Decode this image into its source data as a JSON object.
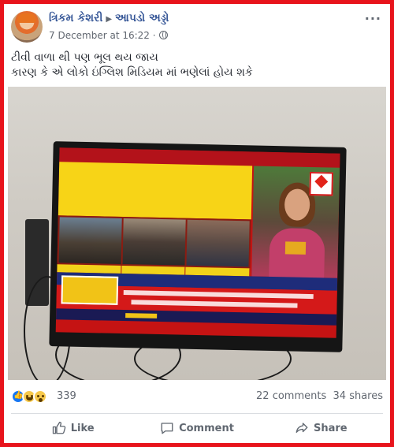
{
  "post": {
    "author": "ત્રિકમ કેશરી",
    "group": "આપડો અડ્ડો",
    "timestamp": "7 December at 16:22",
    "menu_icon": "more-dots-icon",
    "privacy_icon": "globe-icon",
    "text_line1": "ટીવી વાળા થી પણ ભૂલ થય જાય",
    "text_line2": "કારણ કે એ લોકો ઇંગ્લિશ મિડિયમ માં ભણેલાં હોય શકે"
  },
  "reactions": {
    "icons": [
      "like-icon",
      "haha-icon",
      "wow-icon"
    ],
    "count": "339",
    "comments": "22 comments",
    "shares": "34 shares"
  },
  "actions": {
    "like": "Like",
    "comment": "Comment",
    "share": "Share"
  },
  "colors": {
    "frame": "#e8141c",
    "link": "#385898",
    "muted": "#616770"
  }
}
